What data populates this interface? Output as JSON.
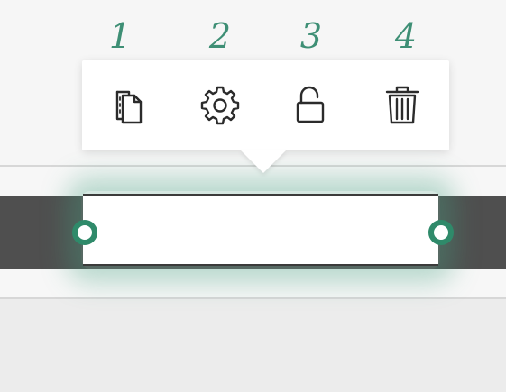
{
  "annotations": {
    "labels": [
      "1",
      "2",
      "3",
      "4"
    ]
  },
  "toolbar": {
    "buttons": [
      {
        "icon": "duplicate-icon"
      },
      {
        "icon": "gear-icon"
      },
      {
        "icon": "unlock-icon"
      },
      {
        "icon": "trash-icon"
      }
    ]
  },
  "colors": {
    "accent": "#2f8a6a",
    "annotation": "#3e8f75",
    "dark_band": "#4f4f4f"
  }
}
